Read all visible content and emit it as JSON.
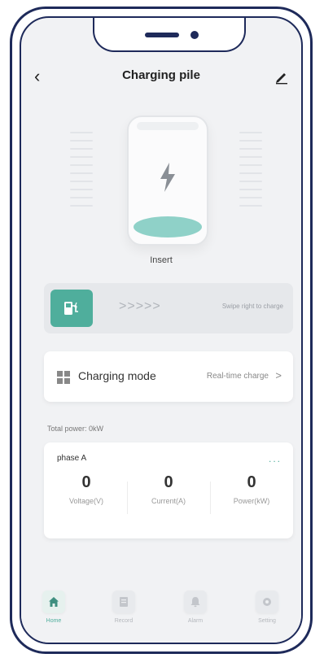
{
  "header": {
    "title": "Charging pile",
    "back_icon": "chevron-left-icon",
    "edit_icon": "pencil-icon"
  },
  "device": {
    "status_label": "Insert",
    "icon": "lightning-bolt-icon"
  },
  "swipe": {
    "arrows": ">>>>>",
    "hint": "Swipe right to charge",
    "knob_icon": "charger-plug-icon",
    "accent": "#4fae9c"
  },
  "mode": {
    "label": "Charging mode",
    "value": "Real-time charge",
    "chevron": ">",
    "icon": "grid-icon"
  },
  "total_power": "Total power:  0kW",
  "phase": {
    "name": "phase A",
    "more": "...",
    "metrics": [
      {
        "value": "0",
        "label": "Voltage(V)"
      },
      {
        "value": "0",
        "label": "Current(A)"
      },
      {
        "value": "0",
        "label": "Power(kW)"
      }
    ]
  },
  "tabs": [
    {
      "label": "Home",
      "icon": "home-icon",
      "active": true
    },
    {
      "label": "Record",
      "icon": "document-icon",
      "active": false
    },
    {
      "label": "Alarm",
      "icon": "bell-icon",
      "active": false
    },
    {
      "label": "Setting",
      "icon": "gear-icon",
      "active": false
    }
  ]
}
